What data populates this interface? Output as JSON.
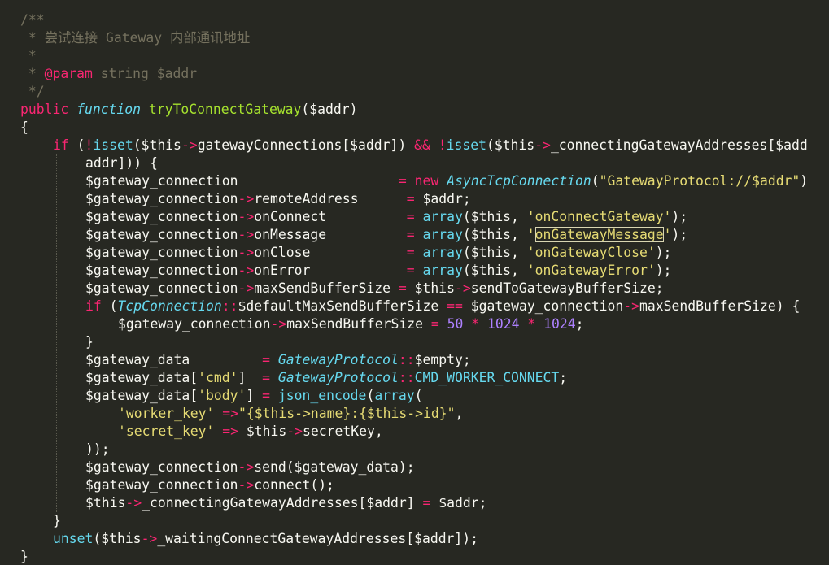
{
  "editor": {
    "colors": {
      "background": "#272822",
      "comment": "#75715e",
      "keyword": "#f92672",
      "string": "#e6db74",
      "function": "#a6e22e",
      "number": "#ae81ff",
      "type": "#66d9ef"
    },
    "lines": [
      {
        "indent": 0,
        "tokens": [
          {
            "c": "c",
            "t": "/**"
          }
        ]
      },
      {
        "indent": 0,
        "tokens": [
          {
            "c": "c",
            "t": " * 尝试连接 Gateway 内部通讯地址"
          }
        ]
      },
      {
        "indent": 0,
        "tokens": [
          {
            "c": "c",
            "t": " *"
          }
        ]
      },
      {
        "indent": 0,
        "tokens": [
          {
            "c": "c",
            "t": " * "
          },
          {
            "c": "k",
            "t": "@param"
          },
          {
            "c": "c",
            "t": " string $addr"
          }
        ]
      },
      {
        "indent": 0,
        "tokens": [
          {
            "c": "c",
            "t": " */"
          }
        ]
      },
      {
        "indent": 0,
        "tokens": [
          {
            "c": "k",
            "t": "public"
          },
          {
            "t": " "
          },
          {
            "c": "it",
            "t": "function"
          },
          {
            "t": " "
          },
          {
            "c": "f",
            "t": "tryToConnectGateway"
          },
          {
            "t": "($addr)"
          }
        ]
      },
      {
        "indent": 0,
        "tokens": [
          {
            "t": "{"
          }
        ]
      },
      {
        "indent": 1,
        "tokens": [
          {
            "c": "k",
            "t": "if"
          },
          {
            "t": " ("
          },
          {
            "c": "k",
            "t": "!"
          },
          {
            "c": "sf",
            "t": "isset"
          },
          {
            "t": "($this"
          },
          {
            "c": "k",
            "t": "->"
          },
          {
            "t": "gatewayConnections[$addr]) "
          },
          {
            "c": "k",
            "t": "&&"
          },
          {
            "t": " "
          },
          {
            "c": "k",
            "t": "!"
          },
          {
            "c": "sf",
            "t": "isset"
          },
          {
            "t": "($this"
          },
          {
            "c": "k",
            "t": "->"
          },
          {
            "t": "_connectingGatewayAddresses[$add"
          }
        ]
      },
      {
        "indent": 2,
        "tokens": [
          {
            "t": "addr])) {"
          }
        ]
      },
      {
        "indent": 2,
        "tokens": [
          {
            "t": "$gateway_connection                    "
          },
          {
            "c": "k",
            "t": "="
          },
          {
            "t": " "
          },
          {
            "c": "k",
            "t": "new"
          },
          {
            "t": " "
          },
          {
            "c": "it",
            "t": "AsyncTcpConnection"
          },
          {
            "t": "("
          },
          {
            "c": "s",
            "t": "\"GatewayProtocol://$addr\""
          },
          {
            "t": ")"
          }
        ]
      },
      {
        "indent": 2,
        "tokens": [
          {
            "t": "$gateway_connection"
          },
          {
            "c": "k",
            "t": "->"
          },
          {
            "t": "remoteAddress      "
          },
          {
            "c": "k",
            "t": "="
          },
          {
            "t": " $addr;"
          }
        ]
      },
      {
        "indent": 2,
        "tokens": [
          {
            "t": "$gateway_connection"
          },
          {
            "c": "k",
            "t": "->"
          },
          {
            "t": "onConnect          "
          },
          {
            "c": "k",
            "t": "="
          },
          {
            "t": " "
          },
          {
            "c": "sf",
            "t": "array"
          },
          {
            "t": "($this, "
          },
          {
            "c": "s",
            "t": "'onConnectGateway'"
          },
          {
            "t": ");"
          }
        ]
      },
      {
        "indent": 2,
        "tokens": [
          {
            "t": "$gateway_connection"
          },
          {
            "c": "k",
            "t": "->"
          },
          {
            "t": "onMessage          "
          },
          {
            "c": "k",
            "t": "="
          },
          {
            "t": " "
          },
          {
            "c": "sf",
            "t": "array"
          },
          {
            "t": "($this, "
          },
          {
            "c": "s",
            "t": "'"
          },
          {
            "c": "s bx",
            "t": "onGatewayMessage"
          },
          {
            "c": "s",
            "t": "'"
          },
          {
            "t": ");"
          }
        ]
      },
      {
        "indent": 2,
        "tokens": [
          {
            "t": "$gateway_connection"
          },
          {
            "c": "k",
            "t": "->"
          },
          {
            "t": "onClose            "
          },
          {
            "c": "k",
            "t": "="
          },
          {
            "t": " "
          },
          {
            "c": "sf",
            "t": "array"
          },
          {
            "t": "($this, "
          },
          {
            "c": "s",
            "t": "'onGatewayClose'"
          },
          {
            "t": ");"
          }
        ]
      },
      {
        "indent": 2,
        "tokens": [
          {
            "t": "$gateway_connection"
          },
          {
            "c": "k",
            "t": "->"
          },
          {
            "t": "onError            "
          },
          {
            "c": "k",
            "t": "="
          },
          {
            "t": " "
          },
          {
            "c": "sf",
            "t": "array"
          },
          {
            "t": "($this, "
          },
          {
            "c": "s",
            "t": "'onGatewayError'"
          },
          {
            "t": ");"
          }
        ]
      },
      {
        "indent": 2,
        "tokens": [
          {
            "t": "$gateway_connection"
          },
          {
            "c": "k",
            "t": "->"
          },
          {
            "t": "maxSendBufferSize "
          },
          {
            "c": "k",
            "t": "="
          },
          {
            "t": " $this"
          },
          {
            "c": "k",
            "t": "->"
          },
          {
            "t": "sendToGatewayBufferSize;"
          }
        ]
      },
      {
        "indent": 2,
        "tokens": [
          {
            "c": "k",
            "t": "if"
          },
          {
            "t": " ("
          },
          {
            "c": "it",
            "t": "TcpConnection"
          },
          {
            "c": "k",
            "t": "::"
          },
          {
            "t": "$defaultMaxSendBufferSize "
          },
          {
            "c": "k",
            "t": "=="
          },
          {
            "t": " $gateway_connection"
          },
          {
            "c": "k",
            "t": "->"
          },
          {
            "t": "maxSendBufferSize) {"
          }
        ]
      },
      {
        "indent": 3,
        "tokens": [
          {
            "t": "$gateway_connection"
          },
          {
            "c": "k",
            "t": "->"
          },
          {
            "t": "maxSendBufferSize "
          },
          {
            "c": "k",
            "t": "="
          },
          {
            "t": " "
          },
          {
            "c": "n",
            "t": "50"
          },
          {
            "t": " "
          },
          {
            "c": "k",
            "t": "*"
          },
          {
            "t": " "
          },
          {
            "c": "n",
            "t": "1024"
          },
          {
            "t": " "
          },
          {
            "c": "k",
            "t": "*"
          },
          {
            "t": " "
          },
          {
            "c": "n",
            "t": "1024"
          },
          {
            "t": ";"
          }
        ]
      },
      {
        "indent": 2,
        "tokens": [
          {
            "t": "}"
          }
        ]
      },
      {
        "indent": 2,
        "tokens": [
          {
            "t": "$gateway_data         "
          },
          {
            "c": "k",
            "t": "="
          },
          {
            "t": " "
          },
          {
            "c": "it",
            "t": "GatewayProtocol"
          },
          {
            "c": "k",
            "t": "::"
          },
          {
            "t": "$empty;"
          }
        ]
      },
      {
        "indent": 2,
        "tokens": [
          {
            "t": "$gateway_data["
          },
          {
            "c": "s",
            "t": "'cmd'"
          },
          {
            "t": "]  "
          },
          {
            "c": "k",
            "t": "="
          },
          {
            "t": " "
          },
          {
            "c": "it",
            "t": "GatewayProtocol"
          },
          {
            "c": "k",
            "t": "::"
          },
          {
            "c": "sf",
            "t": "CMD_WORKER_CONNECT"
          },
          {
            "t": ";"
          }
        ]
      },
      {
        "indent": 2,
        "tokens": [
          {
            "t": "$gateway_data["
          },
          {
            "c": "s",
            "t": "'body'"
          },
          {
            "t": "] "
          },
          {
            "c": "k",
            "t": "="
          },
          {
            "t": " "
          },
          {
            "c": "sf",
            "t": "json_encode"
          },
          {
            "t": "("
          },
          {
            "c": "sf",
            "t": "array"
          },
          {
            "t": "("
          }
        ]
      },
      {
        "indent": 3,
        "tokens": [
          {
            "c": "s",
            "t": "'worker_key'"
          },
          {
            "t": " "
          },
          {
            "c": "k",
            "t": "=>"
          },
          {
            "c": "s",
            "t": "\"{$this->name}:{$this->id}\""
          },
          {
            "t": ","
          }
        ]
      },
      {
        "indent": 3,
        "tokens": [
          {
            "c": "s",
            "t": "'secret_key'"
          },
          {
            "t": " "
          },
          {
            "c": "k",
            "t": "=>"
          },
          {
            "t": " $this"
          },
          {
            "c": "k",
            "t": "->"
          },
          {
            "t": "secretKey,"
          }
        ]
      },
      {
        "indent": 2,
        "tokens": [
          {
            "t": "));"
          }
        ]
      },
      {
        "indent": 2,
        "tokens": [
          {
            "t": "$gateway_connection"
          },
          {
            "c": "k",
            "t": "->"
          },
          {
            "t": "send($gateway_data);"
          }
        ]
      },
      {
        "indent": 2,
        "tokens": [
          {
            "t": "$gateway_connection"
          },
          {
            "c": "k",
            "t": "->"
          },
          {
            "t": "connect();"
          }
        ]
      },
      {
        "indent": 2,
        "tokens": [
          {
            "t": "$this"
          },
          {
            "c": "k",
            "t": "->"
          },
          {
            "t": "_connectingGatewayAddresses[$addr] "
          },
          {
            "c": "k",
            "t": "="
          },
          {
            "t": " $addr;"
          }
        ]
      },
      {
        "indent": 1,
        "tokens": [
          {
            "t": "}"
          }
        ]
      },
      {
        "indent": 1,
        "tokens": [
          {
            "c": "sf",
            "t": "unset"
          },
          {
            "t": "($this"
          },
          {
            "c": "k",
            "t": "->"
          },
          {
            "t": "_waitingConnectGatewayAddresses[$addr]);"
          }
        ]
      },
      {
        "indent": 0,
        "tokens": [
          {
            "t": "}"
          }
        ]
      }
    ]
  }
}
